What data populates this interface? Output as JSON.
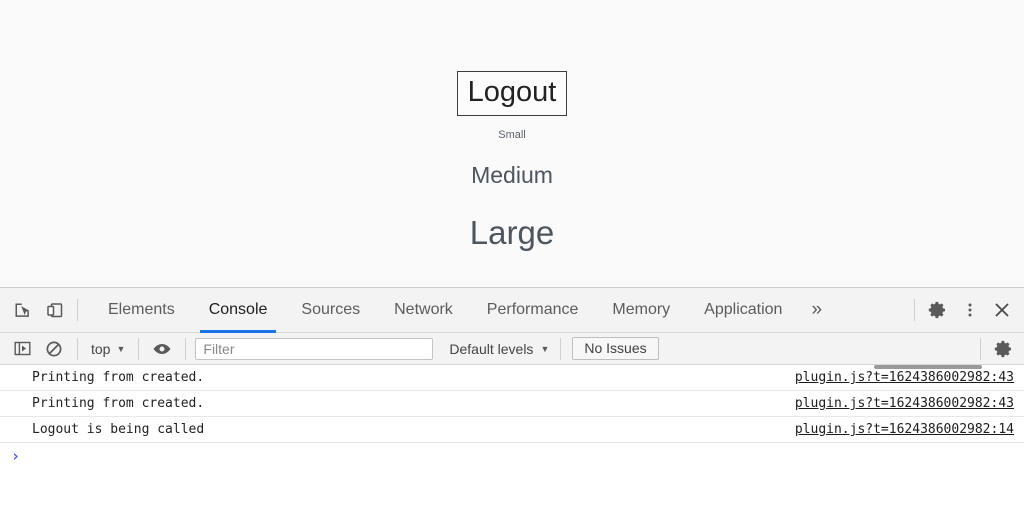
{
  "page": {
    "logout_button_label": "Logout",
    "samples": [
      {
        "name": "small",
        "label": "Small"
      },
      {
        "name": "medium",
        "label": "Medium"
      },
      {
        "name": "large",
        "label": "Large"
      }
    ],
    "background_color": "#fafafa"
  },
  "devtools": {
    "toolbar_icons": {
      "inspect": "inspect-element-icon",
      "device": "device-toolbar-icon",
      "settings": "gear-icon",
      "more": "more-vertical-icon",
      "close": "close-icon"
    },
    "tabs": [
      {
        "label": "Elements",
        "active": false
      },
      {
        "label": "Console",
        "active": true
      },
      {
        "label": "Sources",
        "active": false
      },
      {
        "label": "Network",
        "active": false
      },
      {
        "label": "Performance",
        "active": false
      },
      {
        "label": "Memory",
        "active": false
      },
      {
        "label": "Application",
        "active": false
      }
    ],
    "more_tabs_label": "»",
    "active_tab_underline_color": "#1a73e8",
    "filterbar": {
      "sidebar_icon": "console-sidebar-icon",
      "clear_icon": "clear-console-icon",
      "context_value": "top",
      "eye_icon": "live-expression-eye-icon",
      "filter_placeholder": "Filter",
      "filter_value": "",
      "levels_value": "Default levels",
      "issues_label": "No Issues",
      "settings_icon": "gear-icon",
      "caret": "▼"
    },
    "console": {
      "messages": [
        {
          "text": "Printing from created.",
          "source": "plugin.js?t=1624386002982:43"
        },
        {
          "text": "Printing from created.",
          "source": "plugin.js?t=1624386002982:43"
        },
        {
          "text": "Logout is being called",
          "source": "plugin.js?t=1624386002982:14"
        }
      ],
      "prompt_chevron": "›",
      "prompt_value": ""
    }
  }
}
